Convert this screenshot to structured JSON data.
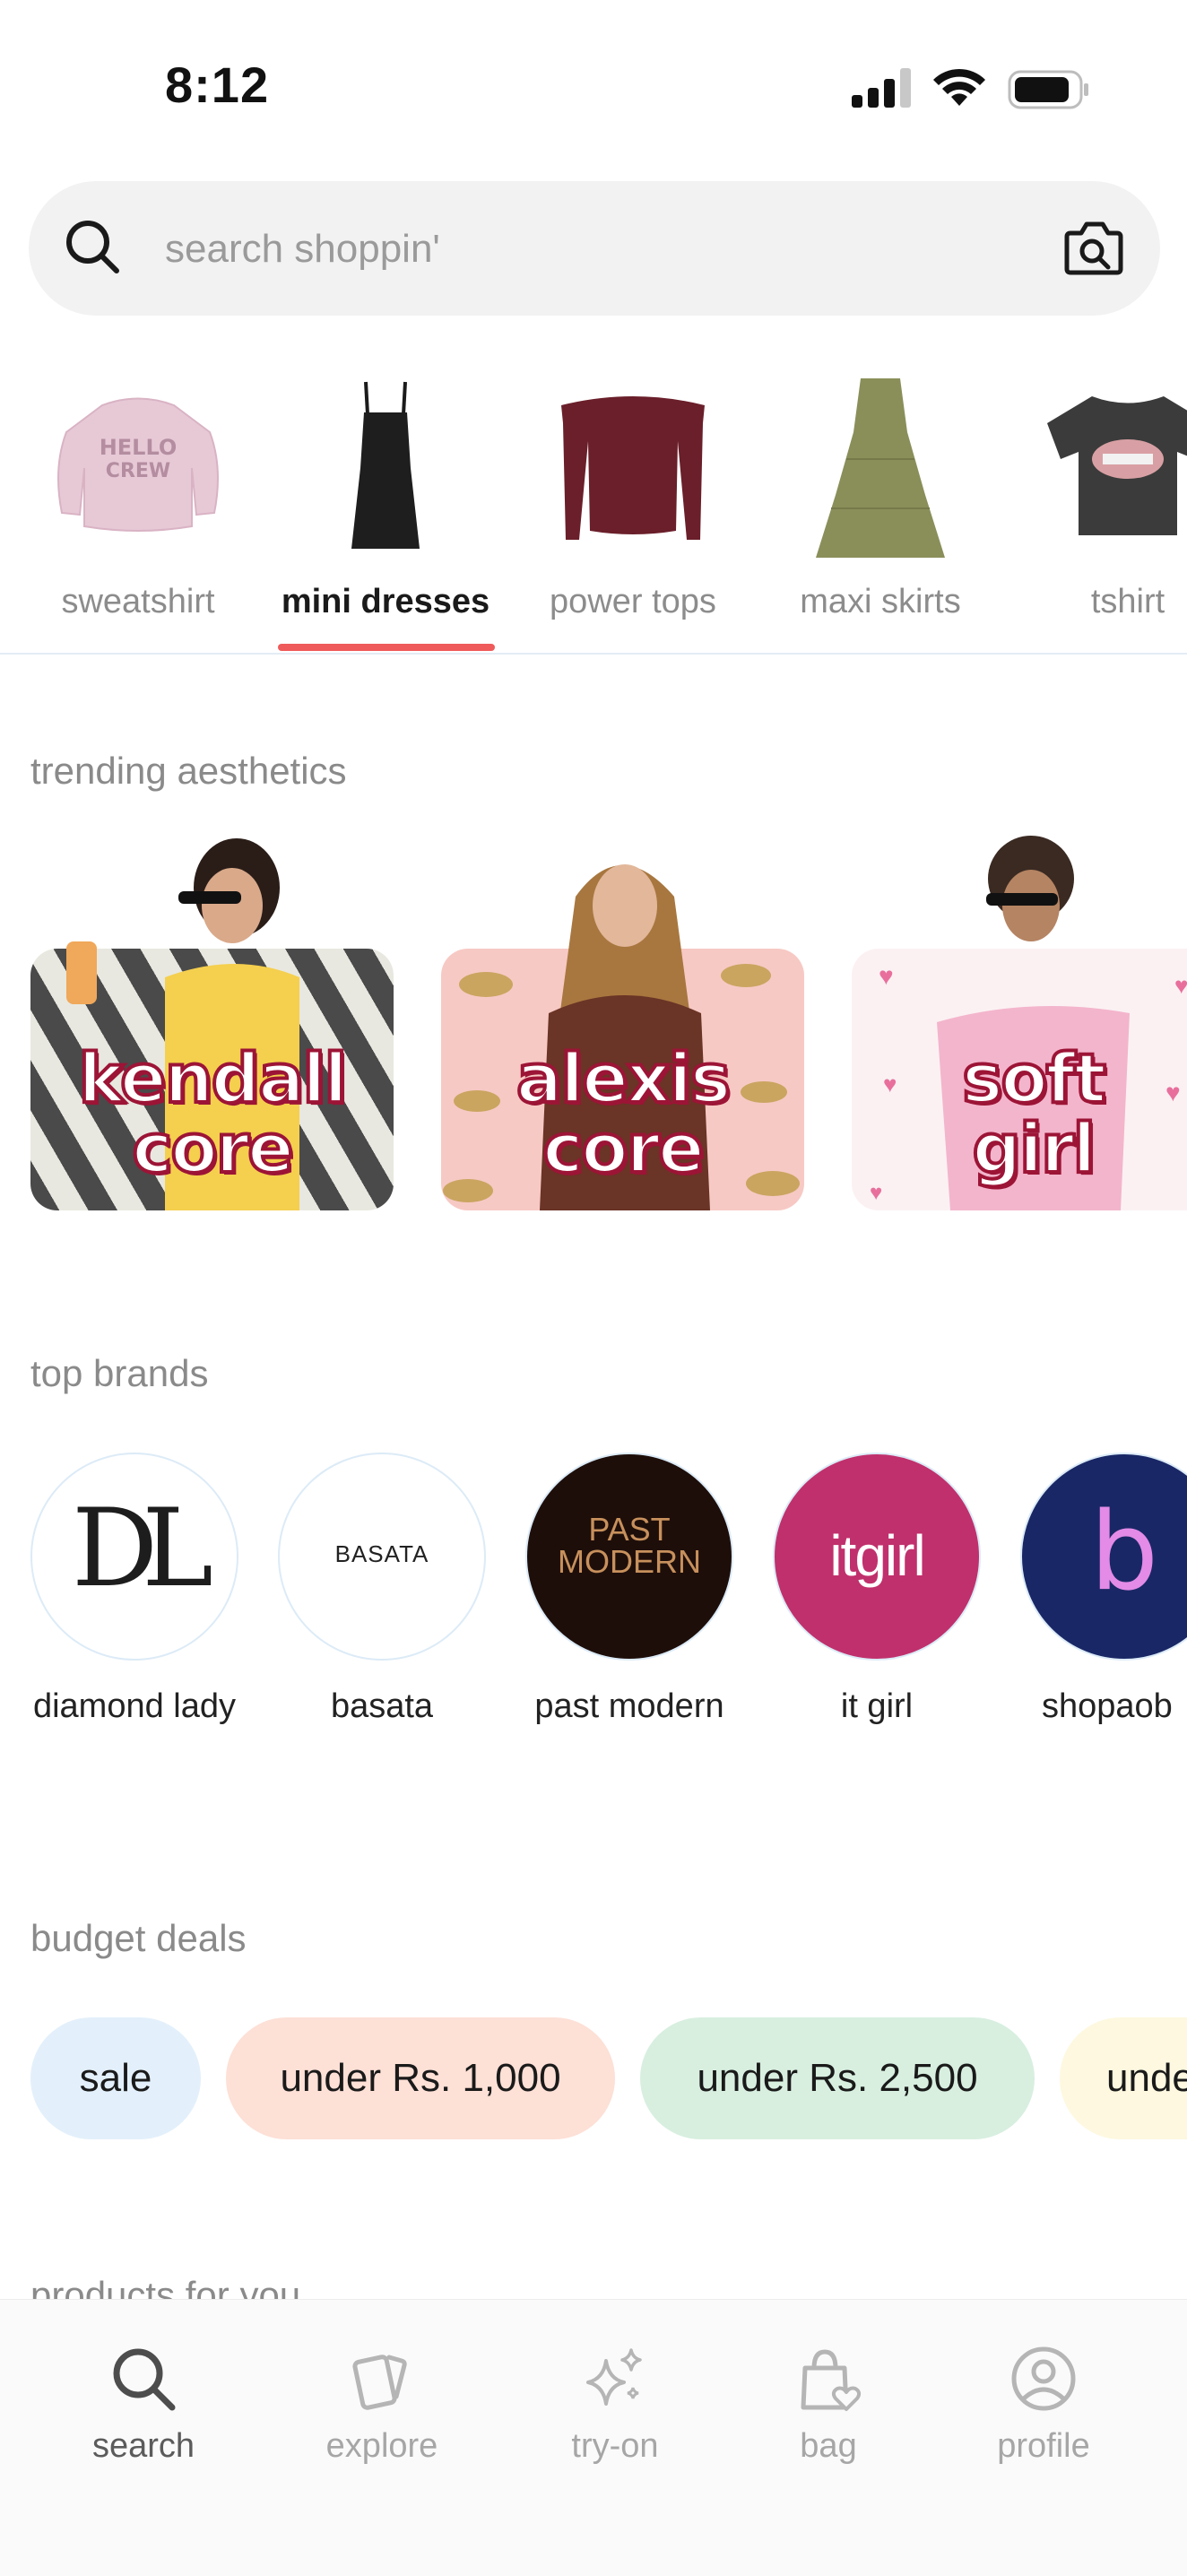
{
  "status_bar": {
    "time": "8:12"
  },
  "search": {
    "placeholder": "search shoppin'"
  },
  "categories": [
    {
      "label": "sweatshirt",
      "active": false
    },
    {
      "label": "mini dresses",
      "active": true
    },
    {
      "label": "power tops",
      "active": false
    },
    {
      "label": "maxi skirts",
      "active": false
    },
    {
      "label": "tshirt",
      "active": false
    }
  ],
  "sections": {
    "trending": "trending aesthetics",
    "brands": "top brands",
    "budget": "budget deals",
    "products": "products for you"
  },
  "aesthetics": [
    {
      "line1": "kendall",
      "line2": "core"
    },
    {
      "line1": "alexis",
      "line2": "core"
    },
    {
      "line1": "soft",
      "line2": "girl"
    }
  ],
  "brands": [
    {
      "name": "diamond lady",
      "logo_text": "DL"
    },
    {
      "name": "basata",
      "logo_text": "BASATA"
    },
    {
      "name": "past modern",
      "logo_text_1": "PAST",
      "logo_text_2": "MODERN"
    },
    {
      "name": "it girl",
      "logo_text": "itgirl"
    },
    {
      "name": "shopaob",
      "logo_text": "b"
    }
  ],
  "budget_deals": [
    {
      "label": "sale",
      "color": "#e3f0fb"
    },
    {
      "label": "under Rs. 1,000",
      "color": "#fde0d6"
    },
    {
      "label": "under Rs. 2,500",
      "color": "#d8efe0"
    },
    {
      "label": "unde",
      "color": "#fdf8df"
    }
  ],
  "tabs": [
    {
      "label": "search",
      "active": true
    },
    {
      "label": "explore",
      "active": false
    },
    {
      "label": "try-on",
      "active": false
    },
    {
      "label": "bag",
      "active": false
    },
    {
      "label": "profile",
      "active": false
    }
  ],
  "colors": {
    "accent": "#ef5a5a",
    "aesthetic_text_stroke": "#9c1436"
  }
}
